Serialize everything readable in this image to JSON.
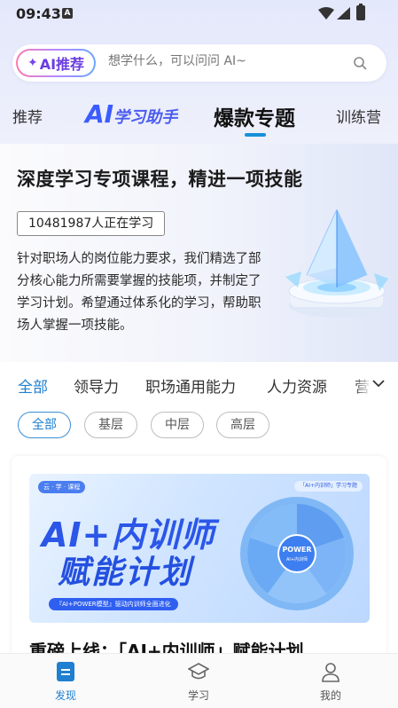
{
  "status_bar": {
    "time": "09:43",
    "notification_icon": "a-icon",
    "wifi_icon": "wifi-icon",
    "signal_icon": "signal-icon",
    "battery_icon": "battery-icon"
  },
  "search": {
    "ai_badge": "AI推荐",
    "placeholder": "想学什么，可以问问 AI~"
  },
  "tabs": [
    {
      "label": "推荐"
    },
    {
      "label_big": "AI",
      "label_small": "学习助手"
    },
    {
      "label": "爆款专题",
      "active": true
    },
    {
      "label": "训练营"
    }
  ],
  "banner": {
    "title": "深度学习专项课程，精进一项技能",
    "learner_count": "10481987人正在学习",
    "description": "针对职场人的岗位能力要求，我们精选了部分核心能力所需要掌握的技能项，并制定了学习计划。希望通过体系化的学习，帮助职场人掌握一项技能。"
  },
  "categories": {
    "items": [
      "全部",
      "领导力",
      "职场通用能力",
      "人力资源",
      "营销"
    ],
    "active_index": 0
  },
  "levels": {
    "items": [
      "全部",
      "基层",
      "中层",
      "高层"
    ],
    "active_index": 0
  },
  "card": {
    "image": {
      "tag": "云 · 学 · 课程",
      "title_line1": "AI+内训师",
      "title_line2": "赋能计划",
      "subtitle": "『AI+POWER模型』驱动内训师全面进化",
      "label": "「AI+内训师」学习专题",
      "wheel_center_top": "POWER",
      "wheel_center_bottom": "AI+内训师"
    },
    "title": "重磅上线：「AI+内训师」赋能计划"
  },
  "bottom_nav": [
    {
      "label": "发现",
      "icon": "discover-icon",
      "active": true
    },
    {
      "label": "学习",
      "icon": "graduation-cap-icon",
      "active": false
    },
    {
      "label": "我的",
      "icon": "person-icon",
      "active": false
    }
  ],
  "colors": {
    "accent": "#1f7fd0",
    "ai_purple": "#6a3de0",
    "ai_blue": "#3b5cff"
  }
}
